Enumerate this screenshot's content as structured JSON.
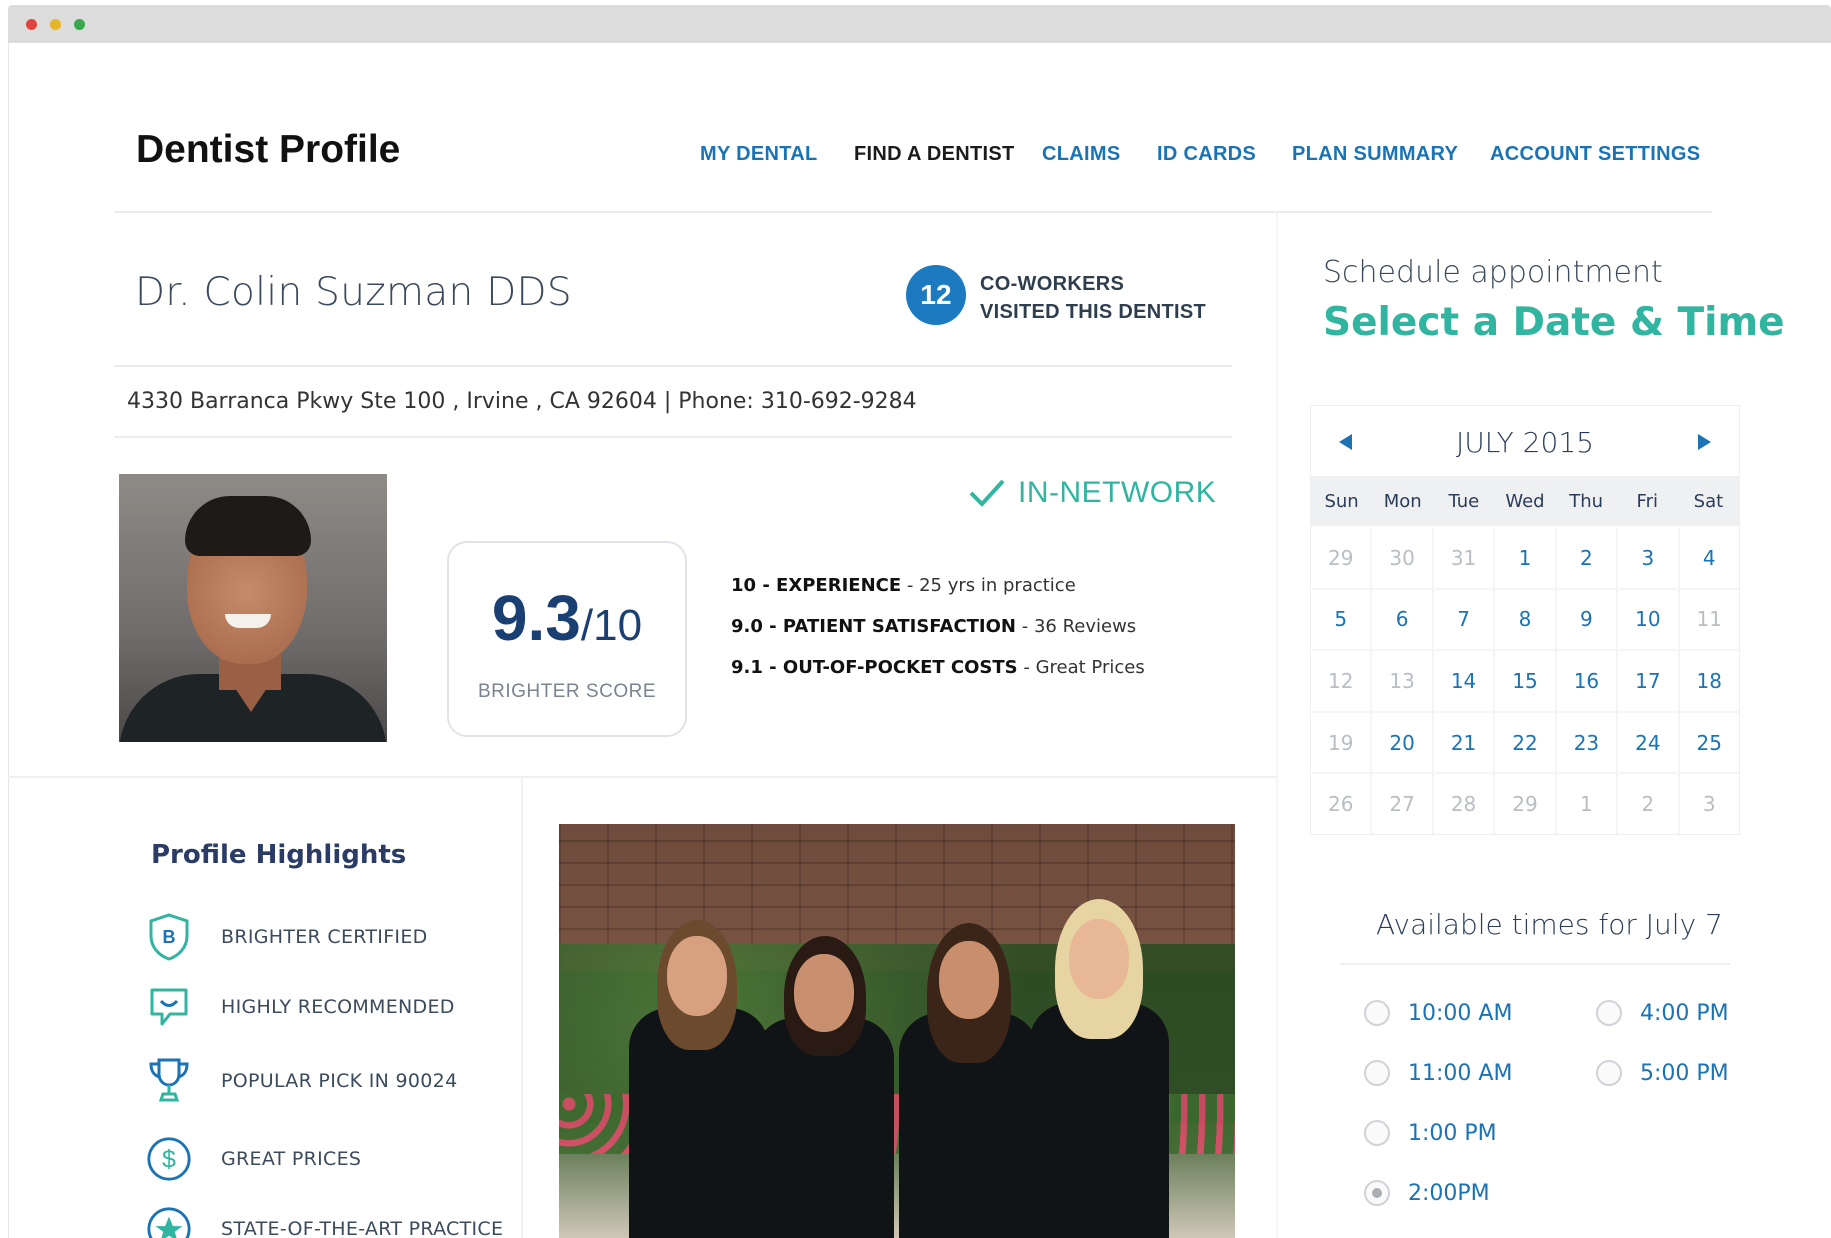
{
  "header": {
    "title": "Dentist Profile",
    "nav": [
      "MY DENTAL",
      "FIND A DENTIST",
      "CLAIMS",
      "ID CARDS",
      "PLAN SUMMARY",
      "ACCOUNT SETTINGS"
    ],
    "active_nav": "FIND A DENTIST"
  },
  "dentist": {
    "name": "Dr. Colin Suzman DDS",
    "coworkers_count": "12",
    "coworkers_line1": "CO-WORKERS",
    "coworkers_line2": "VISITED THIS DENTIST",
    "address": "4330 Barranca Pkwy Ste 100 , Irvine , CA 92604  |  Phone: 310-692-9284",
    "network_status": "IN-NETWORK"
  },
  "score": {
    "value": "9.3",
    "out_of": "/10",
    "label": "BRIGHTER SCORE",
    "metrics": [
      {
        "bold": "10 - EXPERIENCE",
        "rest": " - 25 yrs in practice"
      },
      {
        "bold": "9.0 - PATIENT SATISFACTION",
        "rest": " - 36 Reviews"
      },
      {
        "bold": "9.1 - OUT-OF-POCKET COSTS",
        "rest": " - Great Prices"
      }
    ]
  },
  "highlights": {
    "title": "Profile Highlights",
    "items": [
      {
        "label": "BRIGHTER CERTIFIED",
        "icon": "shield-b-icon"
      },
      {
        "label": "HIGHLY RECOMMENDED",
        "icon": "chat-smile-icon"
      },
      {
        "label": "POPULAR PICK IN 90024",
        "icon": "trophy-icon"
      },
      {
        "label": "GREAT PRICES",
        "icon": "dollar-icon"
      },
      {
        "label": "STATE-OF-THE-ART PRACTICE",
        "icon": "star-badge-icon"
      }
    ]
  },
  "schedule": {
    "label": "Schedule appointment",
    "title": "Select a Date & Time",
    "month": "JULY 2015",
    "days_of_week": [
      "Sun",
      "Mon",
      "Tue",
      "Wed",
      "Thu",
      "Fri",
      "Sat"
    ],
    "days": [
      {
        "d": "29",
        "muted": true
      },
      {
        "d": "30",
        "muted": true
      },
      {
        "d": "31",
        "muted": true
      },
      {
        "d": "1"
      },
      {
        "d": "2"
      },
      {
        "d": "3"
      },
      {
        "d": "4"
      },
      {
        "d": "5"
      },
      {
        "d": "6"
      },
      {
        "d": "7"
      },
      {
        "d": "8"
      },
      {
        "d": "9"
      },
      {
        "d": "10"
      },
      {
        "d": "11",
        "muted": true
      },
      {
        "d": "12",
        "muted": true
      },
      {
        "d": "13",
        "muted": true
      },
      {
        "d": "14"
      },
      {
        "d": "15"
      },
      {
        "d": "16"
      },
      {
        "d": "17"
      },
      {
        "d": "18"
      },
      {
        "d": "19",
        "muted": true
      },
      {
        "d": "20"
      },
      {
        "d": "21"
      },
      {
        "d": "22"
      },
      {
        "d": "23"
      },
      {
        "d": "24"
      },
      {
        "d": "25"
      },
      {
        "d": "26",
        "muted": true
      },
      {
        "d": "27",
        "muted": true
      },
      {
        "d": "28",
        "muted": true
      },
      {
        "d": "29",
        "muted": true
      },
      {
        "d": "1",
        "muted": true
      },
      {
        "d": "2",
        "muted": true
      },
      {
        "d": "3",
        "muted": true
      }
    ],
    "available_title": "Available times for July 7",
    "times": [
      {
        "label": "10:00 AM",
        "checked": false
      },
      {
        "label": "4:00 PM",
        "checked": false
      },
      {
        "label": "11:00 AM",
        "checked": false
      },
      {
        "label": "5:00 PM",
        "checked": false
      },
      {
        "label": "1:00 PM",
        "checked": false
      },
      {
        "label": "2:00PM",
        "checked": true
      }
    ]
  },
  "colors": {
    "link_blue": "#1a73b5",
    "teal": "#2fb5a0",
    "navy": "#1a3f73",
    "badge_blue": "#1c7ac0"
  }
}
